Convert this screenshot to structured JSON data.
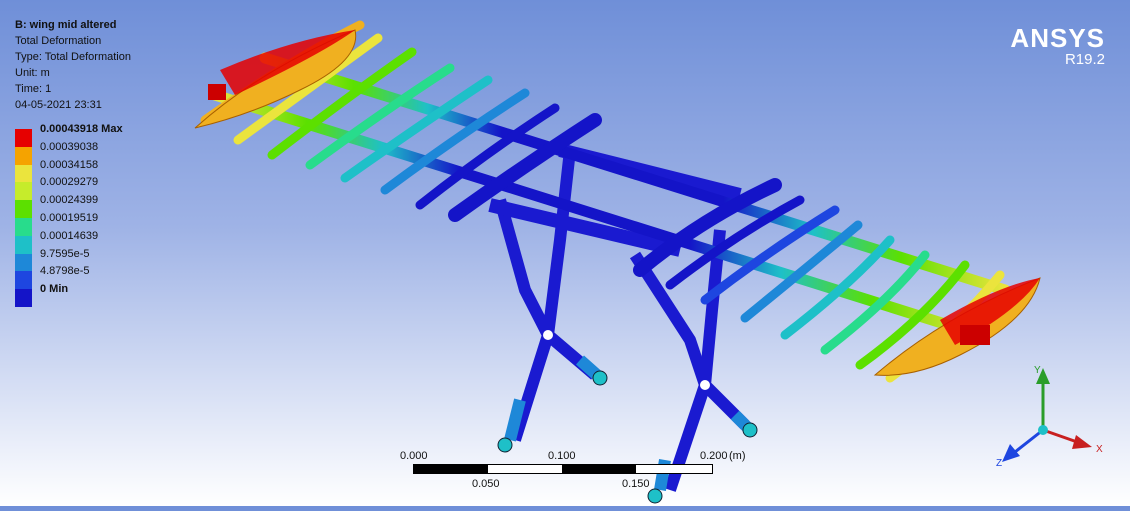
{
  "info": {
    "title": "B: wing mid altered",
    "result": "Total Deformation",
    "type": "Type: Total Deformation",
    "unit": "Unit: m",
    "time": "Time: 1",
    "timestamp": "04-05-2021 23:31"
  },
  "legend": [
    {
      "label": "0.00043918 Max",
      "color": "#e60000",
      "bold": true
    },
    {
      "label": "0.00039038",
      "color": "#f5a300",
      "bold": false
    },
    {
      "label": "0.00034158",
      "color": "#ebe43d",
      "bold": false
    },
    {
      "label": "0.00029279",
      "color": "#c6ec2b",
      "bold": false
    },
    {
      "label": "0.00024399",
      "color": "#5ce000",
      "bold": false
    },
    {
      "label": "0.00019519",
      "color": "#28dc8c",
      "bold": false
    },
    {
      "label": "0.00014639",
      "color": "#1ec0c8",
      "bold": false
    },
    {
      "label": "9.7595e-5",
      "color": "#1e88d8",
      "bold": false
    },
    {
      "label": "4.8798e-5",
      "color": "#1e46e0",
      "bold": false
    },
    {
      "label": "0 Min",
      "color": "#1414c8",
      "bold": true
    }
  ],
  "brand": {
    "name": "ANSYS",
    "version": "R19.2"
  },
  "scale": {
    "top_labels": [
      "0.000",
      "0.100",
      "0.200"
    ],
    "bottom_labels": [
      "0.050",
      "0.150"
    ],
    "unit": "(m)"
  },
  "triad": {
    "x": "X",
    "y": "Y",
    "z": "Z"
  }
}
